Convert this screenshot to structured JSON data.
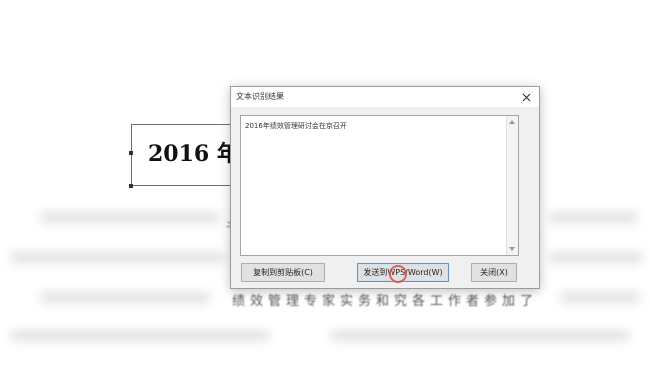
{
  "document": {
    "heading": "2016 年纟",
    "bottom_text": "绩效管理专家实务和究各工作者参加了",
    "side_glyph": "书"
  },
  "dialog": {
    "title": "文本识别结果",
    "close_icon": "close-icon",
    "text_content": "2016年绩效管理研讨会在京召开",
    "buttons": {
      "copy": "复制到剪贴板(C)",
      "send_to_word": "发送到WPS/Word(W)",
      "close": "关闭(X)"
    }
  }
}
